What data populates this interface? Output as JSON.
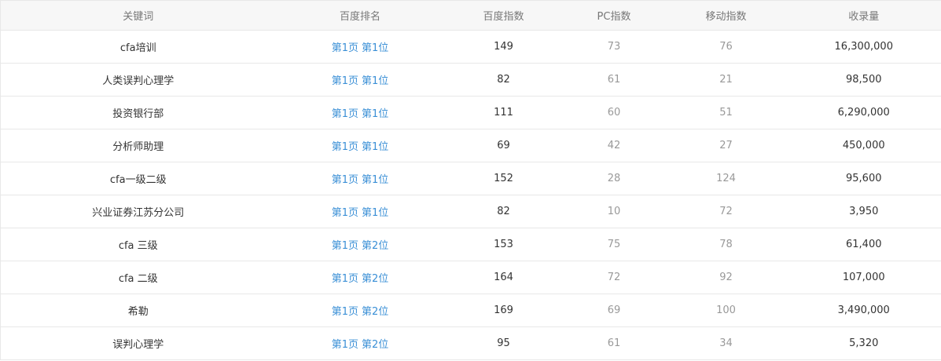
{
  "table": {
    "headers": {
      "keyword": "关键词",
      "baidu_rank": "百度排名",
      "baidu_index": "百度指数",
      "pc_index": "PC指数",
      "mobile_index": "移动指数",
      "indexed_count": "收录量"
    },
    "rows": [
      {
        "keyword": "cfa培训",
        "rank_page": "第1页",
        "rank_pos": "第1位",
        "baidu_index": "149",
        "pc_index": "73",
        "mobile_index": "76",
        "indexed_count": "16,300,000"
      },
      {
        "keyword": "人类误判心理学",
        "rank_page": "第1页",
        "rank_pos": "第1位",
        "baidu_index": "82",
        "pc_index": "61",
        "mobile_index": "21",
        "indexed_count": "98,500"
      },
      {
        "keyword": "投资银行部",
        "rank_page": "第1页",
        "rank_pos": "第1位",
        "baidu_index": "111",
        "pc_index": "60",
        "mobile_index": "51",
        "indexed_count": "6,290,000"
      },
      {
        "keyword": "分析师助理",
        "rank_page": "第1页",
        "rank_pos": "第1位",
        "baidu_index": "69",
        "pc_index": "42",
        "mobile_index": "27",
        "indexed_count": "450,000"
      },
      {
        "keyword": "cfa一级二级",
        "rank_page": "第1页",
        "rank_pos": "第1位",
        "baidu_index": "152",
        "pc_index": "28",
        "mobile_index": "124",
        "indexed_count": "95,600"
      },
      {
        "keyword": "兴业证券江苏分公司",
        "rank_page": "第1页",
        "rank_pos": "第1位",
        "baidu_index": "82",
        "pc_index": "10",
        "mobile_index": "72",
        "indexed_count": "3,950"
      },
      {
        "keyword": "cfa 三级",
        "rank_page": "第1页",
        "rank_pos": "第2位",
        "baidu_index": "153",
        "pc_index": "75",
        "mobile_index": "78",
        "indexed_count": "61,400"
      },
      {
        "keyword": "cfa 二级",
        "rank_page": "第1页",
        "rank_pos": "第2位",
        "baidu_index": "164",
        "pc_index": "72",
        "mobile_index": "92",
        "indexed_count": "107,000"
      },
      {
        "keyword": "希勒",
        "rank_page": "第1页",
        "rank_pos": "第2位",
        "baidu_index": "169",
        "pc_index": "69",
        "mobile_index": "100",
        "indexed_count": "3,490,000"
      },
      {
        "keyword": "误判心理学",
        "rank_page": "第1页",
        "rank_pos": "第2位",
        "baidu_index": "95",
        "pc_index": "61",
        "mobile_index": "34",
        "indexed_count": "5,320"
      }
    ]
  },
  "colors": {
    "link": "#3a8fd6",
    "header_bg": "#f7f7f7",
    "border": "#e8e8e8",
    "muted_text": "#999999",
    "text": "#333333"
  }
}
